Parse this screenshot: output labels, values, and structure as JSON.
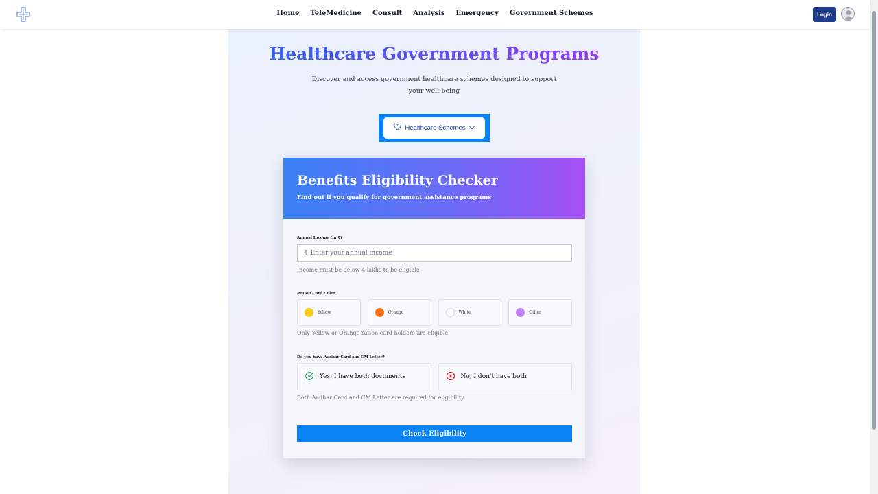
{
  "nav": {
    "items": [
      {
        "label": "Home"
      },
      {
        "label": "TeleMedicine"
      },
      {
        "label": "Consult"
      },
      {
        "label": "Analysis"
      },
      {
        "label": "Emergency"
      },
      {
        "label": "Government Schemes"
      }
    ],
    "login_label": "Login"
  },
  "hero": {
    "title": "Healthcare Government Programs",
    "subtitle": "Discover and access government healthcare schemes designed to support your well-being",
    "dropdown_label": "Healthcare Schemes"
  },
  "checker": {
    "title": "Benefits Eligibility Checker",
    "subtitle": "Find out if you qualify for government assistance programs",
    "income": {
      "label": "Annual Income (in ₹)",
      "currency_symbol": "₹",
      "placeholder": "Enter your annual income",
      "hint": "Income must be below 4 lakhs to be eligible"
    },
    "ration": {
      "label": "Ration Card Color",
      "options": [
        {
          "label": "Yellow",
          "color": "#facc15"
        },
        {
          "label": "Orange",
          "color": "#f97316"
        },
        {
          "label": "White",
          "color": "#ffffff"
        },
        {
          "label": "Other",
          "color": "#c084fc"
        }
      ],
      "hint": "Only Yellow or Orange ration card holders are eligible"
    },
    "documents": {
      "label": "Do you have Aadhar Card and CM Letter?",
      "yes_label": "Yes, I have both documents",
      "no_label": "No, I don't have both",
      "hint": "Both Aadhar Card and CM Letter are required for eligibility"
    },
    "submit_label": "Check Eligibility"
  },
  "colors": {
    "primary": "#0a84f5",
    "brand_dark": "#1e3a8a",
    "gradient_start": "#3b82f6",
    "gradient_end": "#a650f5"
  }
}
